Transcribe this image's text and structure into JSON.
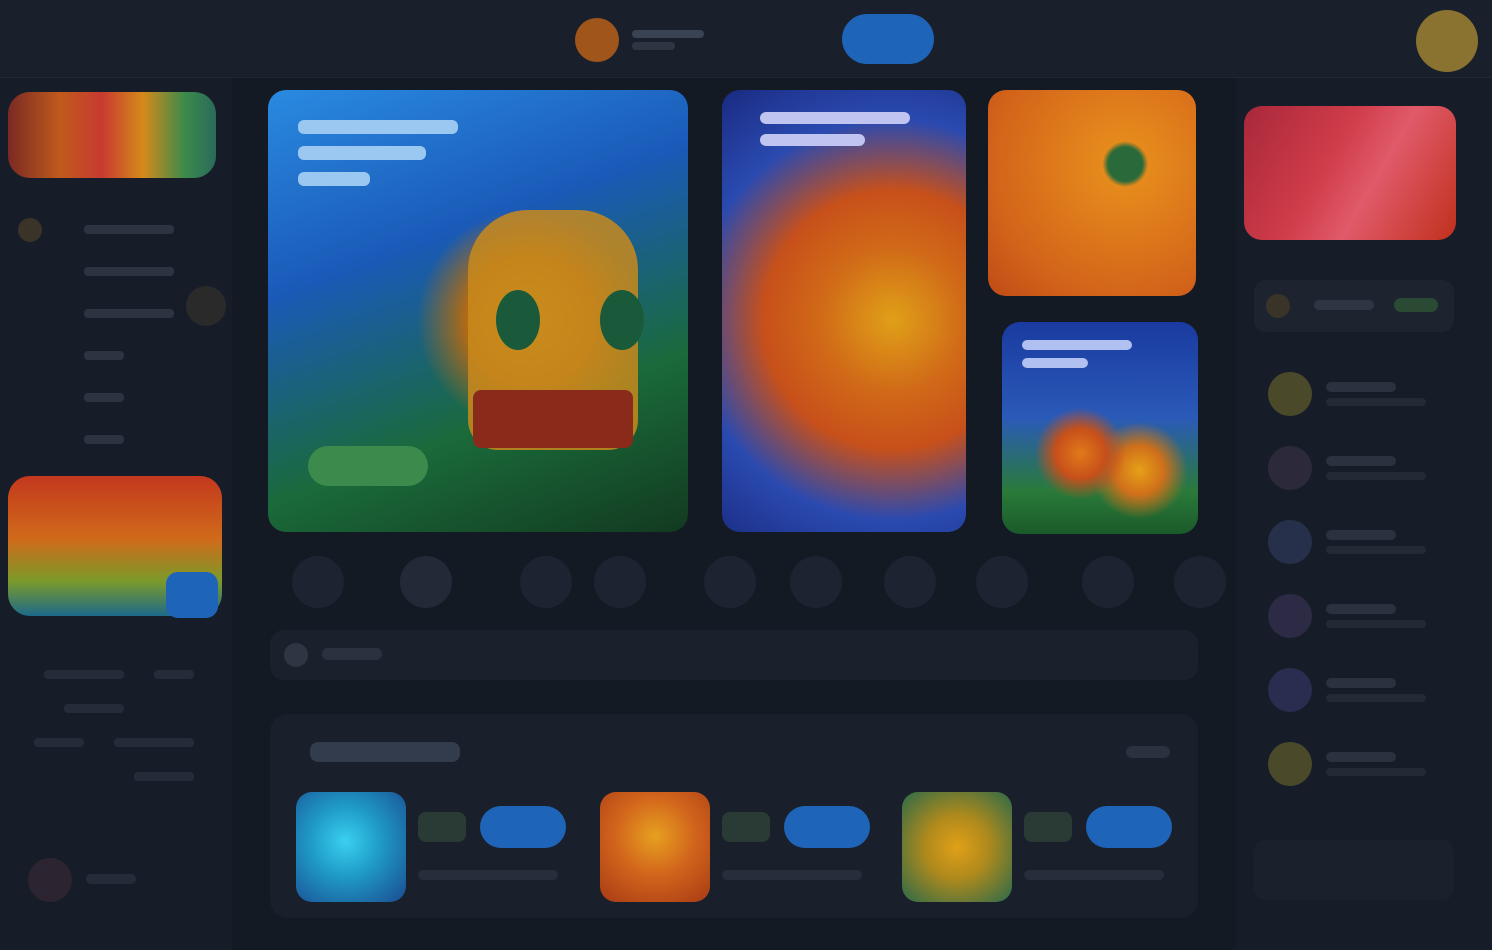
{
  "app": {
    "title": ""
  },
  "topbar": {
    "balance": "",
    "deposit": "",
    "user": ""
  },
  "left_sidebar": {
    "nav_items": [
      "",
      "",
      "",
      "",
      "",
      "",
      ""
    ],
    "links": [
      "",
      "",
      "",
      ""
    ],
    "footer": ""
  },
  "hero": {
    "banner_1": {
      "title": "",
      "cta": ""
    },
    "banner_2": {
      "title": ""
    },
    "banner_4": {
      "title": ""
    }
  },
  "categories": [
    "",
    "",
    "",
    "",
    "",
    "",
    "",
    "",
    "",
    ""
  ],
  "search": {
    "placeholder": ""
  },
  "section": {
    "title": "",
    "see_all": "",
    "games": [
      {
        "name": "",
        "play": "",
        "thumb_color": "#1f9cc8"
      },
      {
        "name": "",
        "play": "",
        "thumb_color": "#d2661c"
      },
      {
        "name": "",
        "play": "",
        "thumb_color": "#b08a1c"
      }
    ]
  },
  "right_sidebar": {
    "tabs": [
      "",
      ""
    ],
    "winners": [
      {
        "name": "",
        "amount": "",
        "avatar_color": "#4a4a2a"
      },
      {
        "name": "",
        "amount": "",
        "avatar_color": "#2c2a3a"
      },
      {
        "name": "",
        "amount": "",
        "avatar_color": "#26304a"
      },
      {
        "name": "",
        "amount": "",
        "avatar_color": "#2c2a44"
      },
      {
        "name": "",
        "amount": "",
        "avatar_color": "#2a2c50"
      },
      {
        "name": "",
        "amount": "",
        "avatar_color": "#4a4a2a"
      }
    ]
  },
  "colors": {
    "accent": "#1e64b8",
    "background": "#141a24",
    "panel": "#1a202b"
  }
}
